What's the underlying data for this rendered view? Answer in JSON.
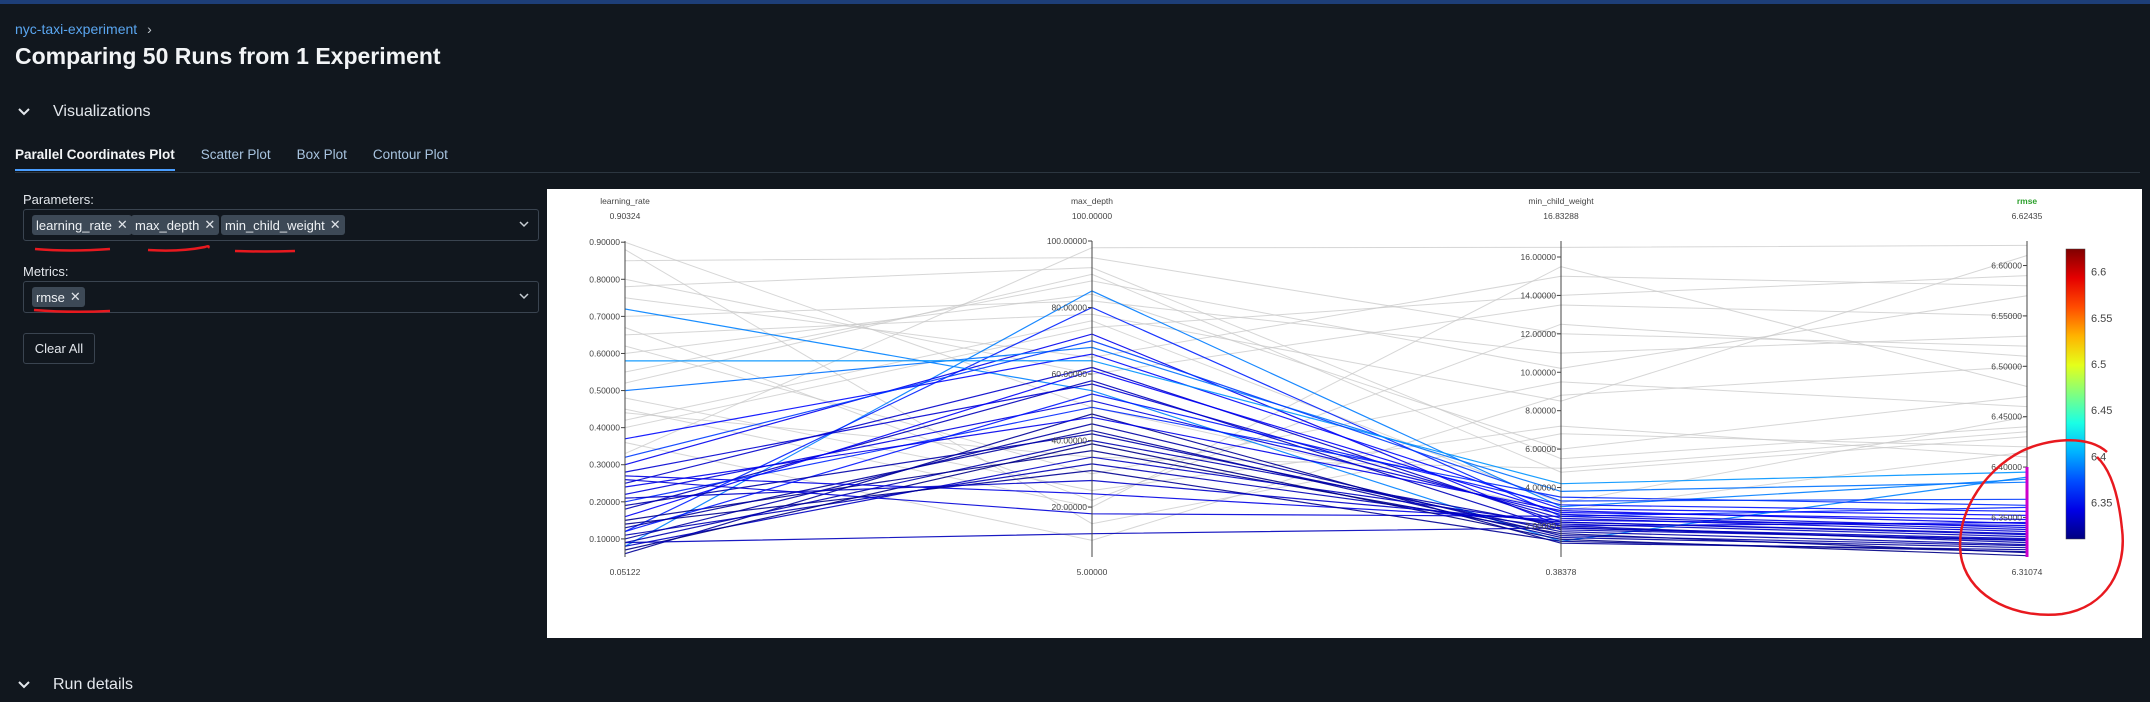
{
  "breadcrumb": {
    "experiment": "nyc-taxi-experiment",
    "separator": "›"
  },
  "page_title": "Comparing 50 Runs from 1 Experiment",
  "visualizations": {
    "title": "Visualizations",
    "icon": "chevron-down-icon"
  },
  "tabs": [
    {
      "label": "Parallel Coordinates Plot",
      "active": true
    },
    {
      "label": "Scatter Plot",
      "active": false
    },
    {
      "label": "Box Plot",
      "active": false
    },
    {
      "label": "Contour Plot",
      "active": false
    }
  ],
  "parameters": {
    "label": "Parameters:",
    "selected": [
      "learning_rate",
      "max_depth",
      "min_child_weight"
    ]
  },
  "metrics": {
    "label": "Metrics:",
    "selected": [
      "rmse"
    ]
  },
  "clear_all_label": "Clear All",
  "run_details": {
    "title": "Run details",
    "icon": "chevron-down-icon"
  },
  "colors": {
    "accent": "#4a9eff",
    "link": "#5aa6f0",
    "background": "#11171e",
    "annotation": "#e8191f",
    "highlight_bar": "#cc00cc"
  },
  "chart_data": {
    "type": "parallel_coordinates",
    "dimensions": [
      {
        "name": "learning_rate",
        "max_label": "0.90324",
        "min_label": "0.05122",
        "range": [
          0.05122,
          0.90324
        ],
        "ticks": [
          "0.10000",
          "0.20000",
          "0.30000",
          "0.40000",
          "0.50000",
          "0.60000",
          "0.70000",
          "0.80000",
          "0.90000"
        ],
        "tick_values": [
          0.1,
          0.2,
          0.3,
          0.4,
          0.5,
          0.6,
          0.7,
          0.8,
          0.9
        ]
      },
      {
        "name": "max_depth",
        "max_label": "100.00000",
        "min_label": "5.00000",
        "range": [
          5,
          100
        ],
        "ticks": [
          "20.00000",
          "40.00000",
          "60.00000",
          "80.00000",
          "100.00000"
        ],
        "tick_values": [
          20,
          40,
          60,
          80,
          100
        ]
      },
      {
        "name": "min_child_weight",
        "max_label": "16.83288",
        "min_label": "0.38378",
        "range": [
          0.38378,
          16.83288
        ],
        "ticks": [
          "2.00000",
          "4.00000",
          "6.00000",
          "8.00000",
          "10.00000",
          "12.00000",
          "14.00000",
          "16.00000"
        ],
        "tick_values": [
          2,
          4,
          6,
          8,
          10,
          12,
          14,
          16
        ]
      },
      {
        "name": "rmse",
        "max_label": "6.62435",
        "min_label": "6.31074",
        "range": [
          6.31074,
          6.62435
        ],
        "ticks": [
          "6.35000",
          "6.40000",
          "6.45000",
          "6.50000",
          "6.55000",
          "6.60000"
        ],
        "tick_values": [
          6.35,
          6.4,
          6.45,
          6.5,
          6.55,
          6.6
        ]
      }
    ],
    "colorbar": {
      "ticks": [
        "6.35",
        "6.4",
        "6.45",
        "6.5",
        "6.55",
        "6.6"
      ],
      "tick_values": [
        6.35,
        6.4,
        6.45,
        6.5,
        6.55,
        6.6
      ],
      "range": [
        6.31074,
        6.62435
      ],
      "colorscale": "jet"
    },
    "constraint_range_rmse": [
      6.31074,
      6.4
    ],
    "runs": [
      [
        0.08,
        85,
        3.0,
        6.388
      ],
      [
        0.12,
        80,
        2.5,
        6.36
      ],
      [
        0.3,
        72,
        2.0,
        6.345
      ],
      [
        0.5,
        68,
        3.8,
        6.385
      ],
      [
        0.72,
        55,
        1.2,
        6.39
      ],
      [
        0.25,
        62,
        2.2,
        6.334
      ],
      [
        0.18,
        58,
        1.8,
        6.328
      ],
      [
        0.1,
        45,
        1.5,
        6.322
      ],
      [
        0.22,
        52,
        2.6,
        6.34
      ],
      [
        0.37,
        66,
        2.9,
        6.352
      ],
      [
        0.06,
        48,
        1.1,
        6.318
      ],
      [
        0.09,
        40,
        2.0,
        6.325
      ],
      [
        0.15,
        37,
        1.6,
        6.315
      ],
      [
        0.28,
        57,
        2.4,
        6.336
      ],
      [
        0.2,
        50,
        3.5,
        6.362
      ],
      [
        0.13,
        43,
        1.4,
        6.32
      ],
      [
        0.08,
        35,
        2.1,
        6.331
      ],
      [
        0.58,
        64,
        4.2,
        6.395
      ],
      [
        0.27,
        24,
        2.3,
        6.342
      ],
      [
        0.11,
        33,
        1.9,
        6.327
      ],
      [
        0.16,
        61,
        2.7,
        6.348
      ],
      [
        0.07,
        39,
        1.3,
        6.312
      ],
      [
        0.24,
        47,
        2.8,
        6.344
      ],
      [
        0.12,
        54,
        3.1,
        6.356
      ],
      [
        0.32,
        70,
        3.3,
        6.368
      ],
      [
        0.19,
        42,
        1.7,
        6.323
      ],
      [
        0.26,
        18,
        2.5,
        6.338
      ],
      [
        0.14,
        31,
        1.2,
        6.316
      ],
      [
        0.21,
        28,
        2.2,
        6.333
      ],
      [
        0.09,
        12,
        1.9,
        6.329
      ],
      [
        0.85,
        95,
        12.0,
        6.52
      ],
      [
        0.65,
        78,
        8.5,
        6.61
      ],
      [
        0.45,
        20,
        15.5,
        6.48
      ],
      [
        0.78,
        92,
        5.5,
        6.44
      ],
      [
        0.55,
        88,
        10.2,
        6.57
      ],
      [
        0.4,
        74,
        14.0,
        6.59
      ],
      [
        0.88,
        15,
        6.8,
        6.42
      ],
      [
        0.62,
        30,
        9.5,
        6.46
      ],
      [
        0.33,
        98,
        16.5,
        6.62
      ],
      [
        0.7,
        82,
        11.0,
        6.53
      ],
      [
        0.48,
        25,
        7.2,
        6.41
      ],
      [
        0.8,
        60,
        13.5,
        6.55
      ],
      [
        0.52,
        90,
        4.8,
        6.43
      ],
      [
        0.36,
        10,
        8.8,
        6.5
      ],
      [
        0.6,
        84,
        6.0,
        6.47
      ],
      [
        0.42,
        76,
        3.2,
        6.45
      ],
      [
        0.75,
        65,
        15.0,
        6.58
      ],
      [
        0.67,
        22,
        12.5,
        6.51
      ],
      [
        0.9,
        50,
        2.8,
        6.415
      ],
      [
        0.44,
        35,
        5.0,
        6.435
      ]
    ]
  }
}
